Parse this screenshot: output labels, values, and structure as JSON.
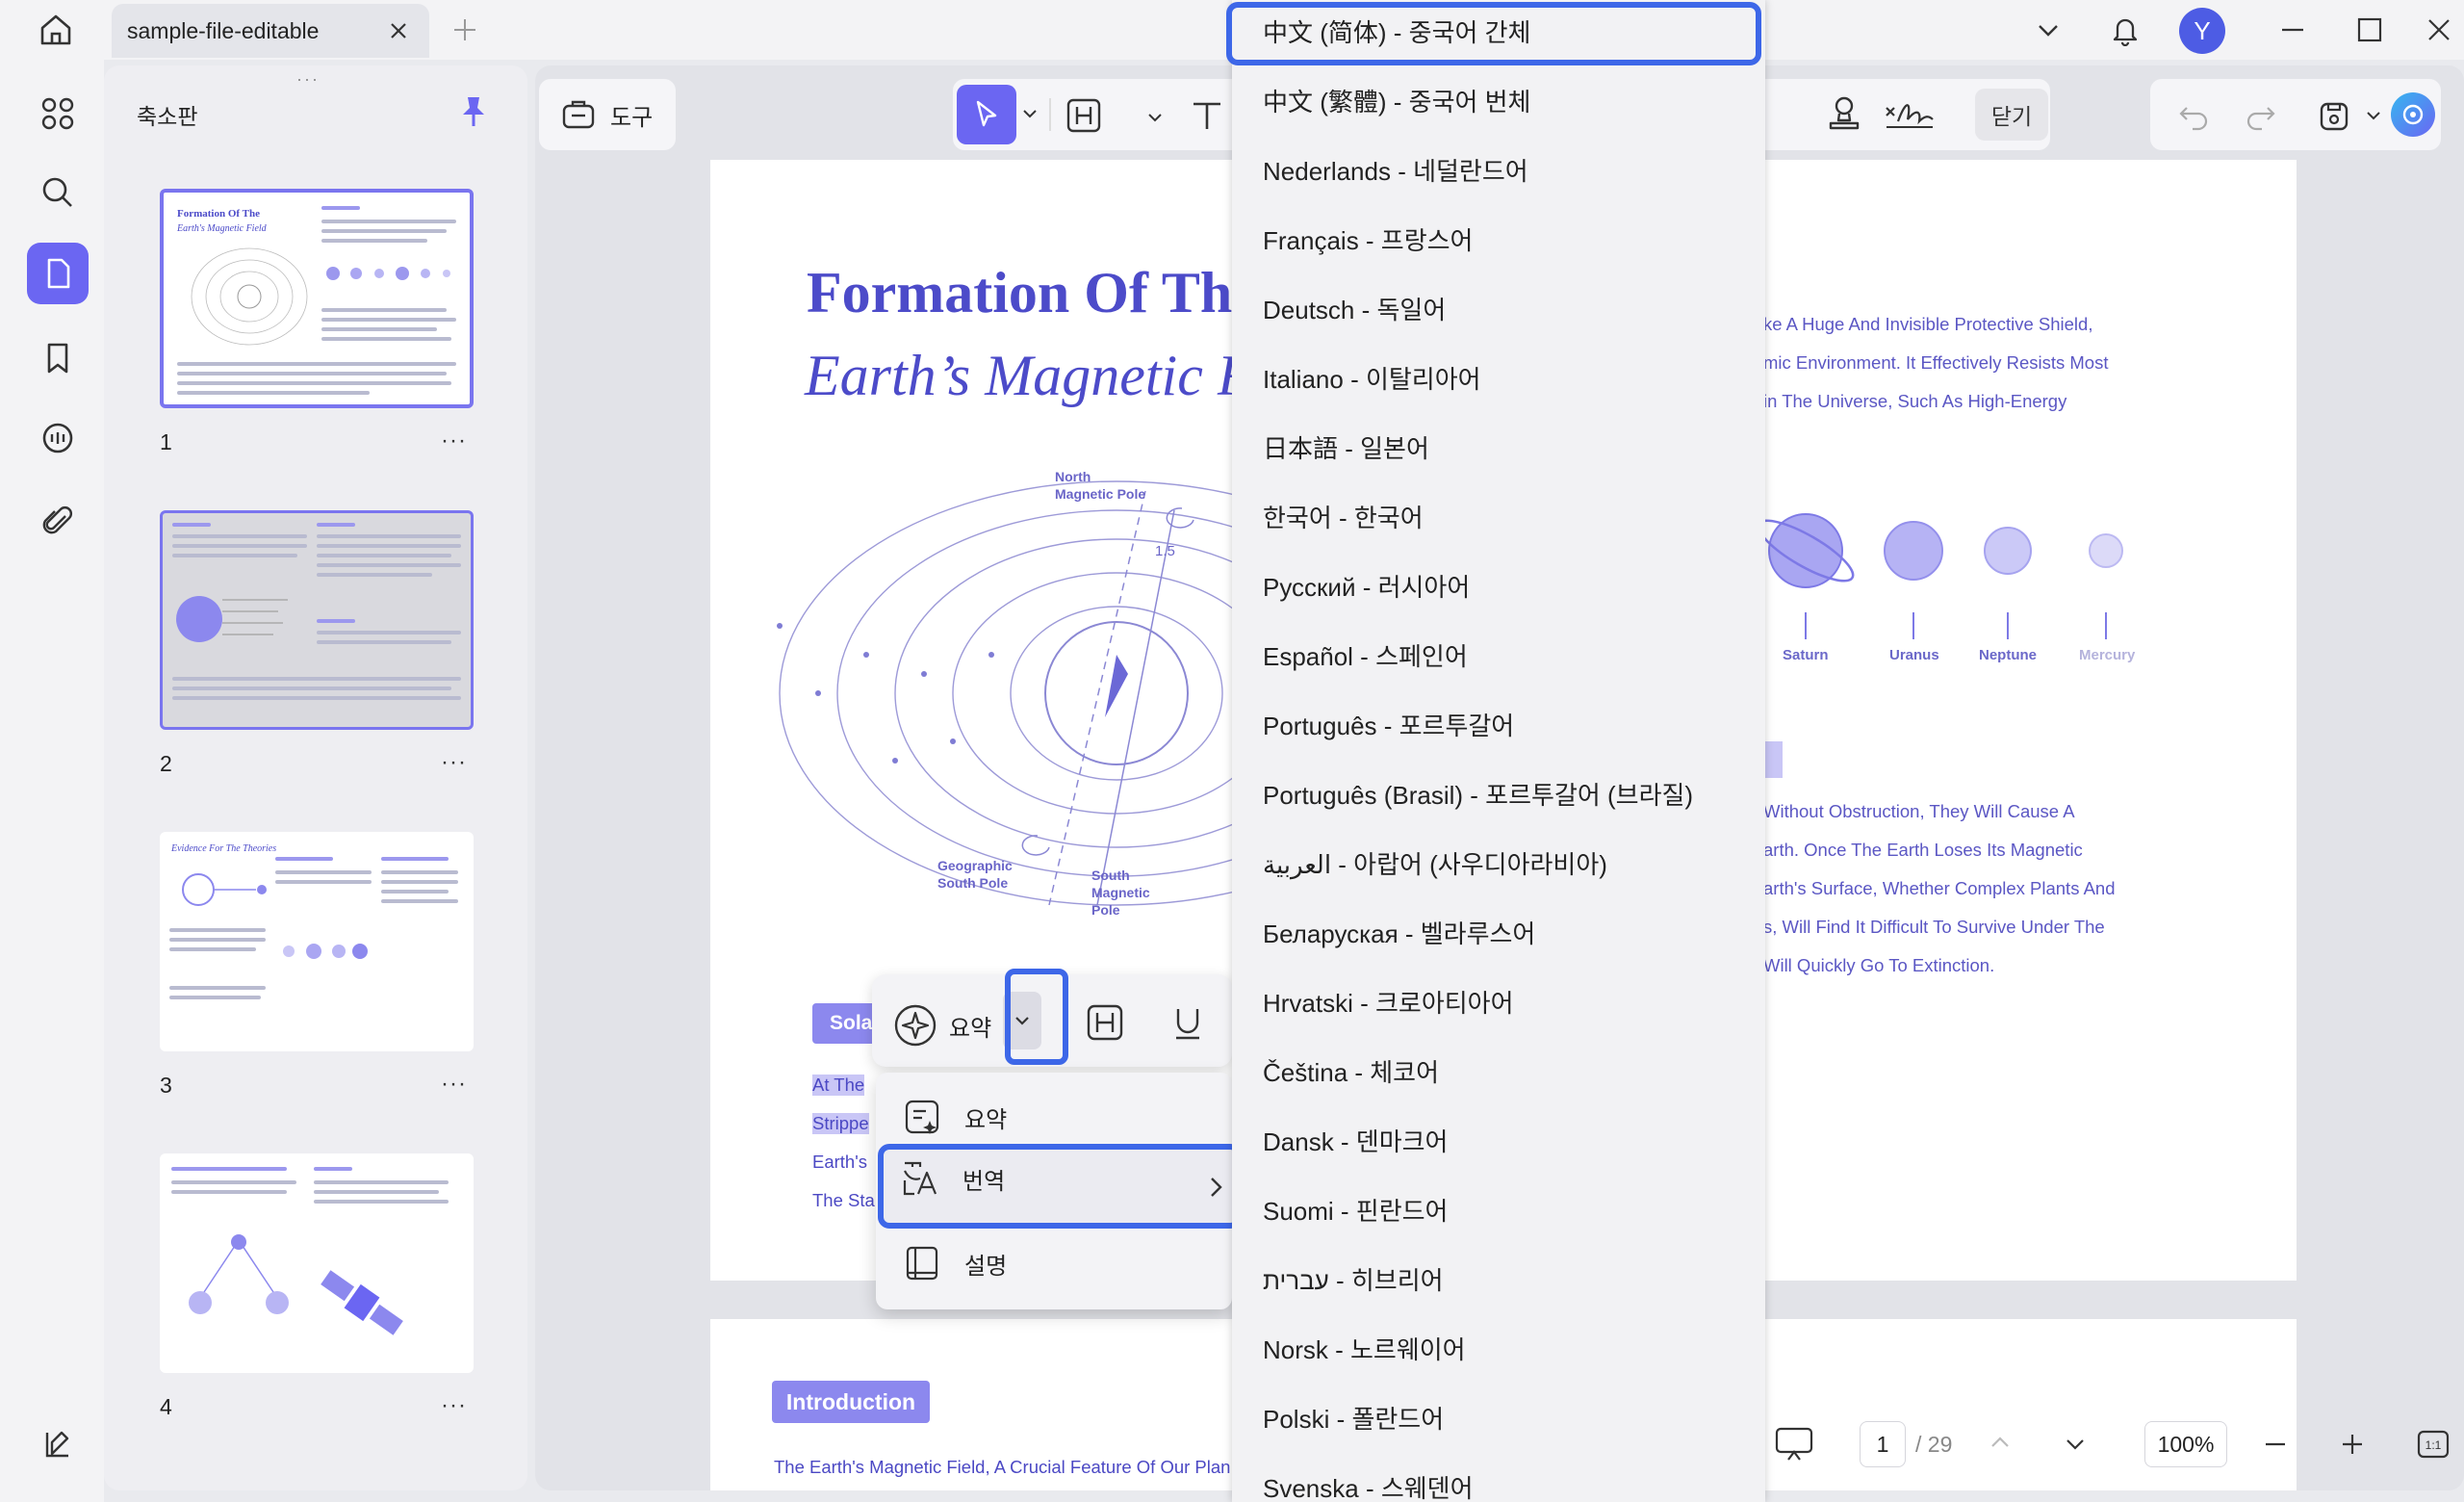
{
  "tab": {
    "title": "sample-file-editable"
  },
  "avatar": {
    "letter": "Y"
  },
  "thumbpanel": {
    "title": "축소판",
    "drag": "···",
    "pages": [
      {
        "number": "1",
        "more": "···"
      },
      {
        "number": "2",
        "more": "···"
      },
      {
        "number": "3",
        "more": "···"
      },
      {
        "number": "4",
        "more": "···"
      }
    ],
    "thumb1_title": "Formation Of The",
    "thumb1_sub": "Earth's Magnetic Field",
    "thumb3_title": "Evidence For The Theories"
  },
  "toolbar": {
    "tools_label": "도구",
    "close_label": "닫기"
  },
  "document": {
    "title1": "Formation Of Th",
    "title2": "Earth’s Magnetic F",
    "labels": {
      "north": "North\nMagnetic Pole",
      "geo_south": "Geographic\nSouth Pole",
      "south_mag": "South\nMagnetic\nPole",
      "value": "1.5"
    },
    "right_lines": [
      "ke A Huge And Invisible Protective Shield,",
      "mic Environment. It Effectively Resists Most",
      "in The Universe, Such As High-Energy"
    ],
    "planets": [
      "Saturn",
      "Uranus",
      "Neptune",
      "Mercury"
    ],
    "right_lines2": [
      "Without Obstruction, They Will Cause A",
      "arth. Once The Earth Loses Its Magnetic",
      "arth's Surface, Whether Complex Plants And",
      "s, Will Find It Difficult To Survive Under The",
      "Will Quickly Go To Extinction."
    ],
    "sola": "Sola",
    "left_lines": [
      "At The",
      "Strippe",
      "Earth's",
      "The Sta"
    ],
    "intro_badge": "Introduction",
    "intro_text": "The Earth's Magnetic Field, A Crucial Feature Of Our Plan"
  },
  "ai_bar": {
    "summary_label": "요약"
  },
  "ai_menu": {
    "items": [
      "요약",
      "번역",
      "설명"
    ]
  },
  "languages": [
    "中文 (简体) - 중국어 간체",
    "中文 (繁體) - 중국어 번체",
    "Nederlands - 네덜란드어",
    "Français - 프랑스어",
    "Deutsch - 독일어",
    "Italiano - 이탈리아어",
    "日本語 - 일본어",
    "한국어 - 한국어",
    "Русский - 러시아어",
    "Español - 스페인어",
    "Português - 포르투갈어",
    "Português (Brasil) - 포르투갈어 (브라질)",
    "العربية - 아랍어 (사우디아라비아)",
    "Беларуская - 벨라루스어",
    "Hrvatski - 크로아티아어",
    "Čeština - 체코어",
    "Dansk - 덴마크어",
    "Suomi - 핀란드어",
    "עברית - 히브리어",
    "Norsk - 노르웨이어",
    "Polski - 폴란드어",
    "Svenska - 스웨덴어"
  ],
  "status": {
    "page": "1",
    "total": "/ 29",
    "zoom": "100%"
  },
  "colors": {
    "accent": "#6b66f2",
    "highlight": "#3d67e8",
    "doc_text": "#4c4bc9"
  }
}
